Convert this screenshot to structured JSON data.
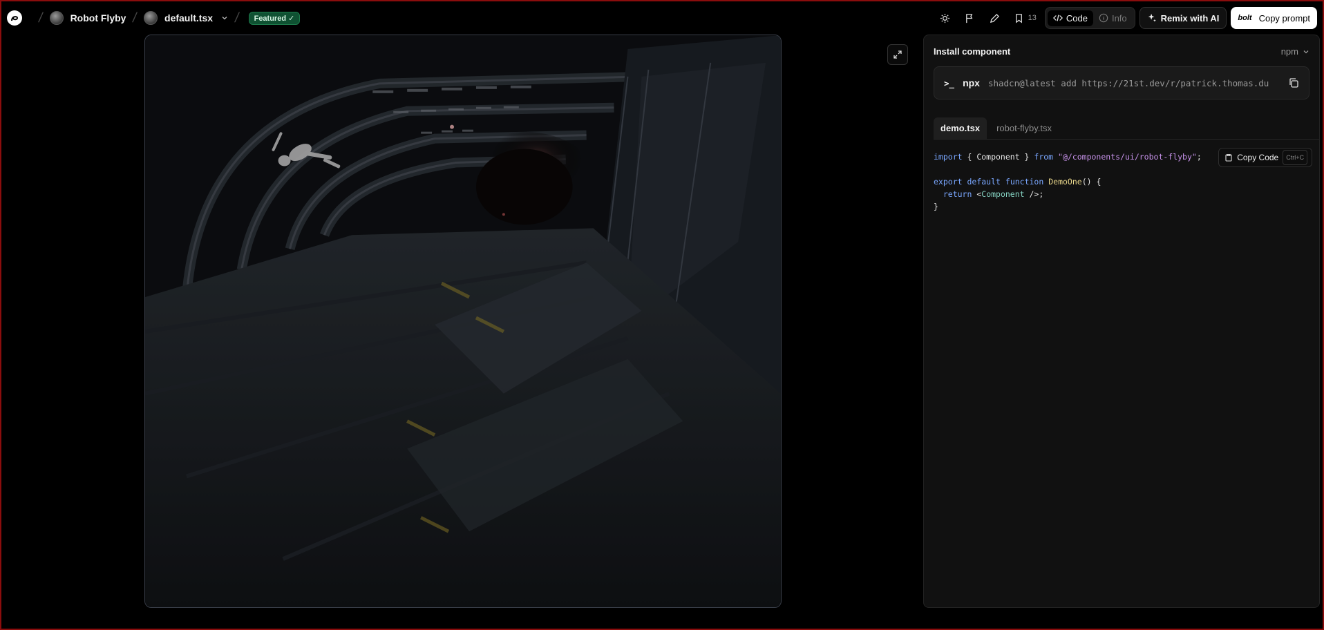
{
  "topbar": {
    "component_name": "Robot Flyby",
    "file_name": "default.tsx",
    "badge": "Featured ✓",
    "bookmark_count": "13",
    "code_label": "Code",
    "info_label": "Info",
    "remix_label": "Remix with AI",
    "bolt_label": "bolt",
    "copy_prompt_label": "Copy prompt"
  },
  "panel": {
    "title": "Install component",
    "package_manager": "npm",
    "command_prompt": ">_",
    "command_bin": "npx",
    "command_args": "shadcn@latest add https://21st.dev/r/patrick.thomas.du",
    "tabs": [
      "demo.tsx",
      "robot-flyby.tsx"
    ],
    "copy_code_label": "Copy Code",
    "copy_code_shortcut": "Ctrl+C",
    "code": {
      "line1_import": "import",
      "line1_mid": " { Component } ",
      "line1_from": "from",
      "line1_path": "\"@/components/ui/robot-flyby\"",
      "line1_end": ";",
      "line3_export": "export",
      "line3_default": "default",
      "line3_function": "function",
      "line3_name": "DemoOne",
      "line3_end": "() {",
      "line4_return": "return",
      "line4_tag_open": " <",
      "line4_component": "Component",
      "line4_tag_close": " />;",
      "line5": "}"
    }
  },
  "colors": {
    "accent_badge": "#0f5132",
    "code_keyword": "#7aa7ff",
    "code_string": "#c792ea"
  }
}
